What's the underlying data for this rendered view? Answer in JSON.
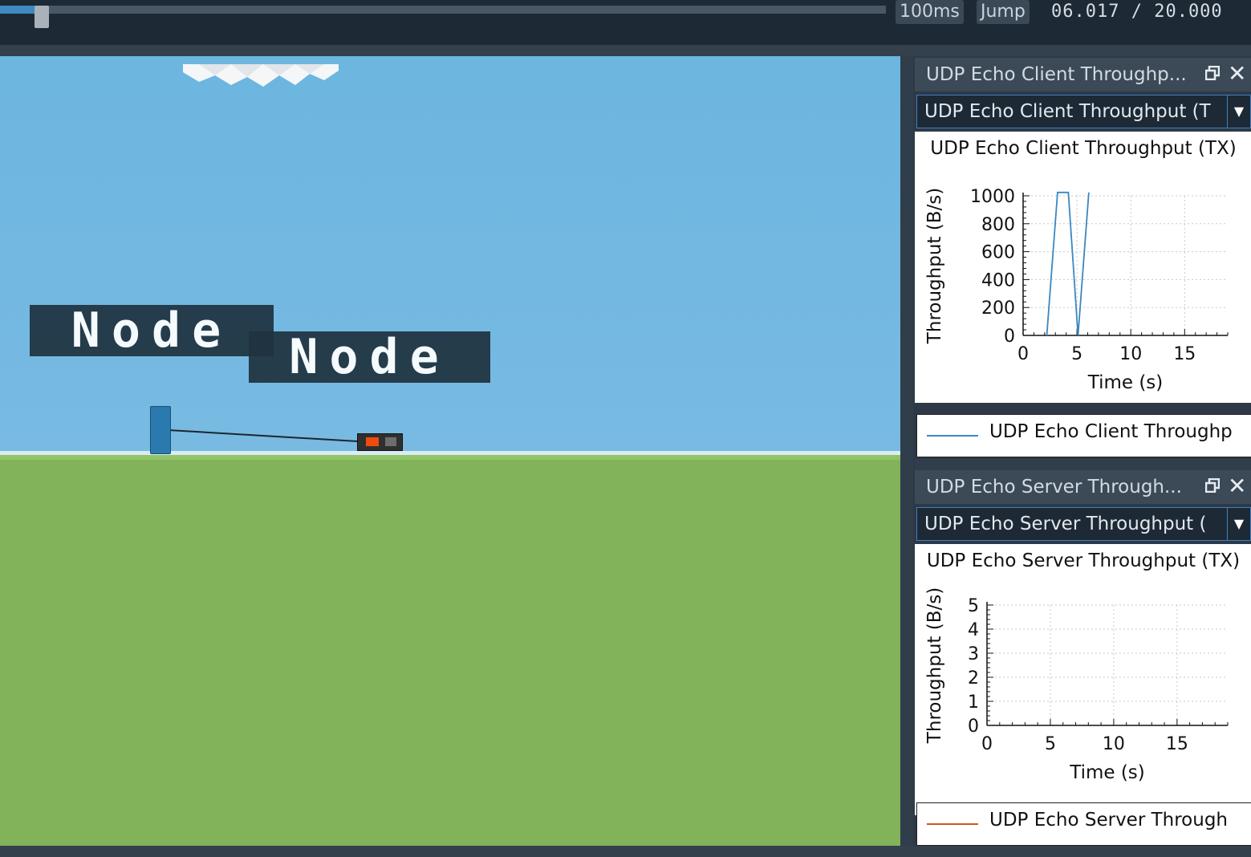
{
  "toolbar": {
    "step_label": "100ms",
    "jump_label": "Jump",
    "time_readout": "06.017 / 20.000",
    "progress_fraction": 0.3
  },
  "scene": {
    "node_labels": [
      "Node",
      "Node"
    ]
  },
  "panels": [
    {
      "title": "UDP Echo Client Throughp...",
      "selected": "UDP Echo Client Throughput (T",
      "series_color": "#3b87c0",
      "legend_label": "UDP Echo Client Throughp",
      "chart_data": {
        "type": "line",
        "title": "UDP Echo Client Throughput (TX)",
        "xlabel": "Time (s)",
        "ylabel": "Throughput (B/s)",
        "xlim": [
          0,
          19
        ],
        "ylim": [
          0,
          1000
        ],
        "x_ticks": [
          "0",
          "5",
          "10",
          "15"
        ],
        "y_ticks": [
          "0",
          "200",
          "400",
          "600",
          "800",
          "1000"
        ],
        "grid": true,
        "series": [
          {
            "name": "UDP Echo Client Throughp",
            "x": [
              2.2,
              3.2,
              4.2,
              5.1,
              6.1
            ],
            "y": [
              0,
              1024,
              1024,
              0,
              1024
            ]
          }
        ]
      }
    },
    {
      "title": "UDP Echo Server Through...",
      "selected": "UDP Echo Server Throughput (",
      "series_color": "#d5531e",
      "legend_label": "UDP Echo Server Through",
      "chart_data": {
        "type": "line",
        "title": "UDP Echo Server Throughput (TX)",
        "xlabel": "Time (s)",
        "ylabel": "Throughput (B/s)",
        "xlim": [
          0,
          19
        ],
        "ylim": [
          0,
          5
        ],
        "x_ticks": [
          "0",
          "5",
          "10",
          "15"
        ],
        "y_ticks": [
          "0",
          "1",
          "2",
          "3",
          "4",
          "5"
        ],
        "grid": true,
        "series": [
          {
            "name": "UDP Echo Server Through",
            "x": [],
            "y": []
          }
        ]
      }
    }
  ]
}
